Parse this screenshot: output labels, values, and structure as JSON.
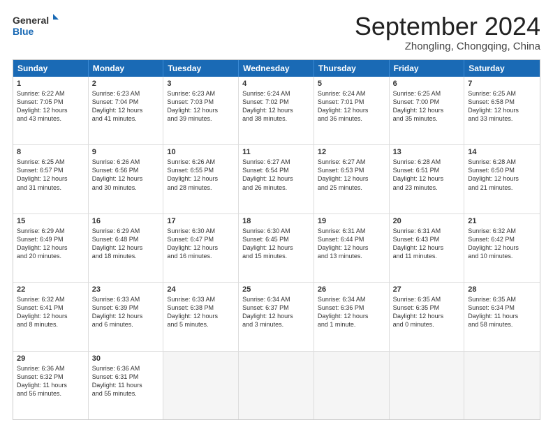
{
  "header": {
    "logo_line1": "General",
    "logo_line2": "Blue",
    "month": "September 2024",
    "location": "Zhongling, Chongqing, China"
  },
  "weekdays": [
    "Sunday",
    "Monday",
    "Tuesday",
    "Wednesday",
    "Thursday",
    "Friday",
    "Saturday"
  ],
  "weeks": [
    [
      {
        "day": "1",
        "lines": [
          "Sunrise: 6:22 AM",
          "Sunset: 7:05 PM",
          "Daylight: 12 hours",
          "and 43 minutes."
        ]
      },
      {
        "day": "2",
        "lines": [
          "Sunrise: 6:23 AM",
          "Sunset: 7:04 PM",
          "Daylight: 12 hours",
          "and 41 minutes."
        ]
      },
      {
        "day": "3",
        "lines": [
          "Sunrise: 6:23 AM",
          "Sunset: 7:03 PM",
          "Daylight: 12 hours",
          "and 39 minutes."
        ]
      },
      {
        "day": "4",
        "lines": [
          "Sunrise: 6:24 AM",
          "Sunset: 7:02 PM",
          "Daylight: 12 hours",
          "and 38 minutes."
        ]
      },
      {
        "day": "5",
        "lines": [
          "Sunrise: 6:24 AM",
          "Sunset: 7:01 PM",
          "Daylight: 12 hours",
          "and 36 minutes."
        ]
      },
      {
        "day": "6",
        "lines": [
          "Sunrise: 6:25 AM",
          "Sunset: 7:00 PM",
          "Daylight: 12 hours",
          "and 35 minutes."
        ]
      },
      {
        "day": "7",
        "lines": [
          "Sunrise: 6:25 AM",
          "Sunset: 6:58 PM",
          "Daylight: 12 hours",
          "and 33 minutes."
        ]
      }
    ],
    [
      {
        "day": "8",
        "lines": [
          "Sunrise: 6:25 AM",
          "Sunset: 6:57 PM",
          "Daylight: 12 hours",
          "and 31 minutes."
        ]
      },
      {
        "day": "9",
        "lines": [
          "Sunrise: 6:26 AM",
          "Sunset: 6:56 PM",
          "Daylight: 12 hours",
          "and 30 minutes."
        ]
      },
      {
        "day": "10",
        "lines": [
          "Sunrise: 6:26 AM",
          "Sunset: 6:55 PM",
          "Daylight: 12 hours",
          "and 28 minutes."
        ]
      },
      {
        "day": "11",
        "lines": [
          "Sunrise: 6:27 AM",
          "Sunset: 6:54 PM",
          "Daylight: 12 hours",
          "and 26 minutes."
        ]
      },
      {
        "day": "12",
        "lines": [
          "Sunrise: 6:27 AM",
          "Sunset: 6:53 PM",
          "Daylight: 12 hours",
          "and 25 minutes."
        ]
      },
      {
        "day": "13",
        "lines": [
          "Sunrise: 6:28 AM",
          "Sunset: 6:51 PM",
          "Daylight: 12 hours",
          "and 23 minutes."
        ]
      },
      {
        "day": "14",
        "lines": [
          "Sunrise: 6:28 AM",
          "Sunset: 6:50 PM",
          "Daylight: 12 hours",
          "and 21 minutes."
        ]
      }
    ],
    [
      {
        "day": "15",
        "lines": [
          "Sunrise: 6:29 AM",
          "Sunset: 6:49 PM",
          "Daylight: 12 hours",
          "and 20 minutes."
        ]
      },
      {
        "day": "16",
        "lines": [
          "Sunrise: 6:29 AM",
          "Sunset: 6:48 PM",
          "Daylight: 12 hours",
          "and 18 minutes."
        ]
      },
      {
        "day": "17",
        "lines": [
          "Sunrise: 6:30 AM",
          "Sunset: 6:47 PM",
          "Daylight: 12 hours",
          "and 16 minutes."
        ]
      },
      {
        "day": "18",
        "lines": [
          "Sunrise: 6:30 AM",
          "Sunset: 6:45 PM",
          "Daylight: 12 hours",
          "and 15 minutes."
        ]
      },
      {
        "day": "19",
        "lines": [
          "Sunrise: 6:31 AM",
          "Sunset: 6:44 PM",
          "Daylight: 12 hours",
          "and 13 minutes."
        ]
      },
      {
        "day": "20",
        "lines": [
          "Sunrise: 6:31 AM",
          "Sunset: 6:43 PM",
          "Daylight: 12 hours",
          "and 11 minutes."
        ]
      },
      {
        "day": "21",
        "lines": [
          "Sunrise: 6:32 AM",
          "Sunset: 6:42 PM",
          "Daylight: 12 hours",
          "and 10 minutes."
        ]
      }
    ],
    [
      {
        "day": "22",
        "lines": [
          "Sunrise: 6:32 AM",
          "Sunset: 6:41 PM",
          "Daylight: 12 hours",
          "and 8 minutes."
        ]
      },
      {
        "day": "23",
        "lines": [
          "Sunrise: 6:33 AM",
          "Sunset: 6:39 PM",
          "Daylight: 12 hours",
          "and 6 minutes."
        ]
      },
      {
        "day": "24",
        "lines": [
          "Sunrise: 6:33 AM",
          "Sunset: 6:38 PM",
          "Daylight: 12 hours",
          "and 5 minutes."
        ]
      },
      {
        "day": "25",
        "lines": [
          "Sunrise: 6:34 AM",
          "Sunset: 6:37 PM",
          "Daylight: 12 hours",
          "and 3 minutes."
        ]
      },
      {
        "day": "26",
        "lines": [
          "Sunrise: 6:34 AM",
          "Sunset: 6:36 PM",
          "Daylight: 12 hours",
          "and 1 minute."
        ]
      },
      {
        "day": "27",
        "lines": [
          "Sunrise: 6:35 AM",
          "Sunset: 6:35 PM",
          "Daylight: 12 hours",
          "and 0 minutes."
        ]
      },
      {
        "day": "28",
        "lines": [
          "Sunrise: 6:35 AM",
          "Sunset: 6:34 PM",
          "Daylight: 11 hours",
          "and 58 minutes."
        ]
      }
    ],
    [
      {
        "day": "29",
        "lines": [
          "Sunrise: 6:36 AM",
          "Sunset: 6:32 PM",
          "Daylight: 11 hours",
          "and 56 minutes."
        ]
      },
      {
        "day": "30",
        "lines": [
          "Sunrise: 6:36 AM",
          "Sunset: 6:31 PM",
          "Daylight: 11 hours",
          "and 55 minutes."
        ]
      },
      {
        "day": "",
        "lines": []
      },
      {
        "day": "",
        "lines": []
      },
      {
        "day": "",
        "lines": []
      },
      {
        "day": "",
        "lines": []
      },
      {
        "day": "",
        "lines": []
      }
    ]
  ]
}
